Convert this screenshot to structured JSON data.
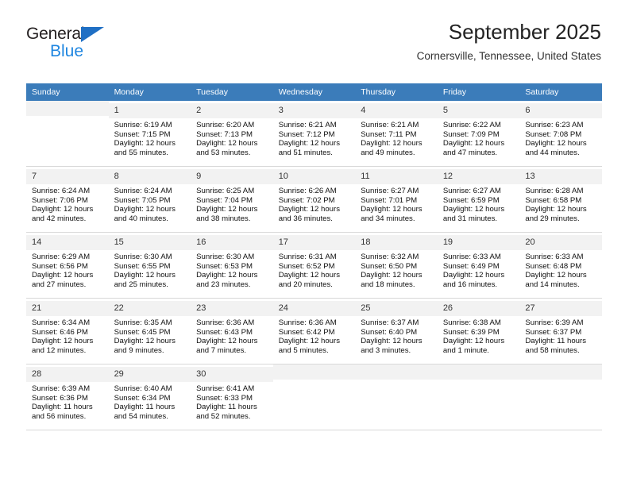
{
  "brand": {
    "name_top": "General",
    "name_bottom": "Blue",
    "triangle_color": "#1f6fc4",
    "blue_color": "#1f86e0"
  },
  "header": {
    "month_title": "September 2025",
    "location": "Cornersville, Tennessee, United States",
    "header_bg_color": "#3b7cba"
  },
  "calendar": {
    "weekday_headers": [
      "Sunday",
      "Monday",
      "Tuesday",
      "Wednesday",
      "Thursday",
      "Friday",
      "Saturday"
    ],
    "weeks": [
      [
        {
          "blank": true
        },
        {
          "day": "1",
          "sunrise": "Sunrise: 6:19 AM",
          "sunset": "Sunset: 7:15 PM",
          "daylight1": "Daylight: 12 hours",
          "daylight2": "and 55 minutes."
        },
        {
          "day": "2",
          "sunrise": "Sunrise: 6:20 AM",
          "sunset": "Sunset: 7:13 PM",
          "daylight1": "Daylight: 12 hours",
          "daylight2": "and 53 minutes."
        },
        {
          "day": "3",
          "sunrise": "Sunrise: 6:21 AM",
          "sunset": "Sunset: 7:12 PM",
          "daylight1": "Daylight: 12 hours",
          "daylight2": "and 51 minutes."
        },
        {
          "day": "4",
          "sunrise": "Sunrise: 6:21 AM",
          "sunset": "Sunset: 7:11 PM",
          "daylight1": "Daylight: 12 hours",
          "daylight2": "and 49 minutes."
        },
        {
          "day": "5",
          "sunrise": "Sunrise: 6:22 AM",
          "sunset": "Sunset: 7:09 PM",
          "daylight1": "Daylight: 12 hours",
          "daylight2": "and 47 minutes."
        },
        {
          "day": "6",
          "sunrise": "Sunrise: 6:23 AM",
          "sunset": "Sunset: 7:08 PM",
          "daylight1": "Daylight: 12 hours",
          "daylight2": "and 44 minutes."
        }
      ],
      [
        {
          "day": "7",
          "sunrise": "Sunrise: 6:24 AM",
          "sunset": "Sunset: 7:06 PM",
          "daylight1": "Daylight: 12 hours",
          "daylight2": "and 42 minutes."
        },
        {
          "day": "8",
          "sunrise": "Sunrise: 6:24 AM",
          "sunset": "Sunset: 7:05 PM",
          "daylight1": "Daylight: 12 hours",
          "daylight2": "and 40 minutes."
        },
        {
          "day": "9",
          "sunrise": "Sunrise: 6:25 AM",
          "sunset": "Sunset: 7:04 PM",
          "daylight1": "Daylight: 12 hours",
          "daylight2": "and 38 minutes."
        },
        {
          "day": "10",
          "sunrise": "Sunrise: 6:26 AM",
          "sunset": "Sunset: 7:02 PM",
          "daylight1": "Daylight: 12 hours",
          "daylight2": "and 36 minutes."
        },
        {
          "day": "11",
          "sunrise": "Sunrise: 6:27 AM",
          "sunset": "Sunset: 7:01 PM",
          "daylight1": "Daylight: 12 hours",
          "daylight2": "and 34 minutes."
        },
        {
          "day": "12",
          "sunrise": "Sunrise: 6:27 AM",
          "sunset": "Sunset: 6:59 PM",
          "daylight1": "Daylight: 12 hours",
          "daylight2": "and 31 minutes."
        },
        {
          "day": "13",
          "sunrise": "Sunrise: 6:28 AM",
          "sunset": "Sunset: 6:58 PM",
          "daylight1": "Daylight: 12 hours",
          "daylight2": "and 29 minutes."
        }
      ],
      [
        {
          "day": "14",
          "sunrise": "Sunrise: 6:29 AM",
          "sunset": "Sunset: 6:56 PM",
          "daylight1": "Daylight: 12 hours",
          "daylight2": "and 27 minutes."
        },
        {
          "day": "15",
          "sunrise": "Sunrise: 6:30 AM",
          "sunset": "Sunset: 6:55 PM",
          "daylight1": "Daylight: 12 hours",
          "daylight2": "and 25 minutes."
        },
        {
          "day": "16",
          "sunrise": "Sunrise: 6:30 AM",
          "sunset": "Sunset: 6:53 PM",
          "daylight1": "Daylight: 12 hours",
          "daylight2": "and 23 minutes."
        },
        {
          "day": "17",
          "sunrise": "Sunrise: 6:31 AM",
          "sunset": "Sunset: 6:52 PM",
          "daylight1": "Daylight: 12 hours",
          "daylight2": "and 20 minutes."
        },
        {
          "day": "18",
          "sunrise": "Sunrise: 6:32 AM",
          "sunset": "Sunset: 6:50 PM",
          "daylight1": "Daylight: 12 hours",
          "daylight2": "and 18 minutes."
        },
        {
          "day": "19",
          "sunrise": "Sunrise: 6:33 AM",
          "sunset": "Sunset: 6:49 PM",
          "daylight1": "Daylight: 12 hours",
          "daylight2": "and 16 minutes."
        },
        {
          "day": "20",
          "sunrise": "Sunrise: 6:33 AM",
          "sunset": "Sunset: 6:48 PM",
          "daylight1": "Daylight: 12 hours",
          "daylight2": "and 14 minutes."
        }
      ],
      [
        {
          "day": "21",
          "sunrise": "Sunrise: 6:34 AM",
          "sunset": "Sunset: 6:46 PM",
          "daylight1": "Daylight: 12 hours",
          "daylight2": "and 12 minutes."
        },
        {
          "day": "22",
          "sunrise": "Sunrise: 6:35 AM",
          "sunset": "Sunset: 6:45 PM",
          "daylight1": "Daylight: 12 hours",
          "daylight2": "and 9 minutes."
        },
        {
          "day": "23",
          "sunrise": "Sunrise: 6:36 AM",
          "sunset": "Sunset: 6:43 PM",
          "daylight1": "Daylight: 12 hours",
          "daylight2": "and 7 minutes."
        },
        {
          "day": "24",
          "sunrise": "Sunrise: 6:36 AM",
          "sunset": "Sunset: 6:42 PM",
          "daylight1": "Daylight: 12 hours",
          "daylight2": "and 5 minutes."
        },
        {
          "day": "25",
          "sunrise": "Sunrise: 6:37 AM",
          "sunset": "Sunset: 6:40 PM",
          "daylight1": "Daylight: 12 hours",
          "daylight2": "and 3 minutes."
        },
        {
          "day": "26",
          "sunrise": "Sunrise: 6:38 AM",
          "sunset": "Sunset: 6:39 PM",
          "daylight1": "Daylight: 12 hours",
          "daylight2": "and 1 minute."
        },
        {
          "day": "27",
          "sunrise": "Sunrise: 6:39 AM",
          "sunset": "Sunset: 6:37 PM",
          "daylight1": "Daylight: 11 hours",
          "daylight2": "and 58 minutes."
        }
      ],
      [
        {
          "day": "28",
          "sunrise": "Sunrise: 6:39 AM",
          "sunset": "Sunset: 6:36 PM",
          "daylight1": "Daylight: 11 hours",
          "daylight2": "and 56 minutes."
        },
        {
          "day": "29",
          "sunrise": "Sunrise: 6:40 AM",
          "sunset": "Sunset: 6:34 PM",
          "daylight1": "Daylight: 11 hours",
          "daylight2": "and 54 minutes."
        },
        {
          "day": "30",
          "sunrise": "Sunrise: 6:41 AM",
          "sunset": "Sunset: 6:33 PM",
          "daylight1": "Daylight: 11 hours",
          "daylight2": "and 52 minutes."
        },
        {
          "blank": true
        },
        {
          "blank": true
        },
        {
          "blank": true
        },
        {
          "blank": true
        }
      ]
    ]
  }
}
